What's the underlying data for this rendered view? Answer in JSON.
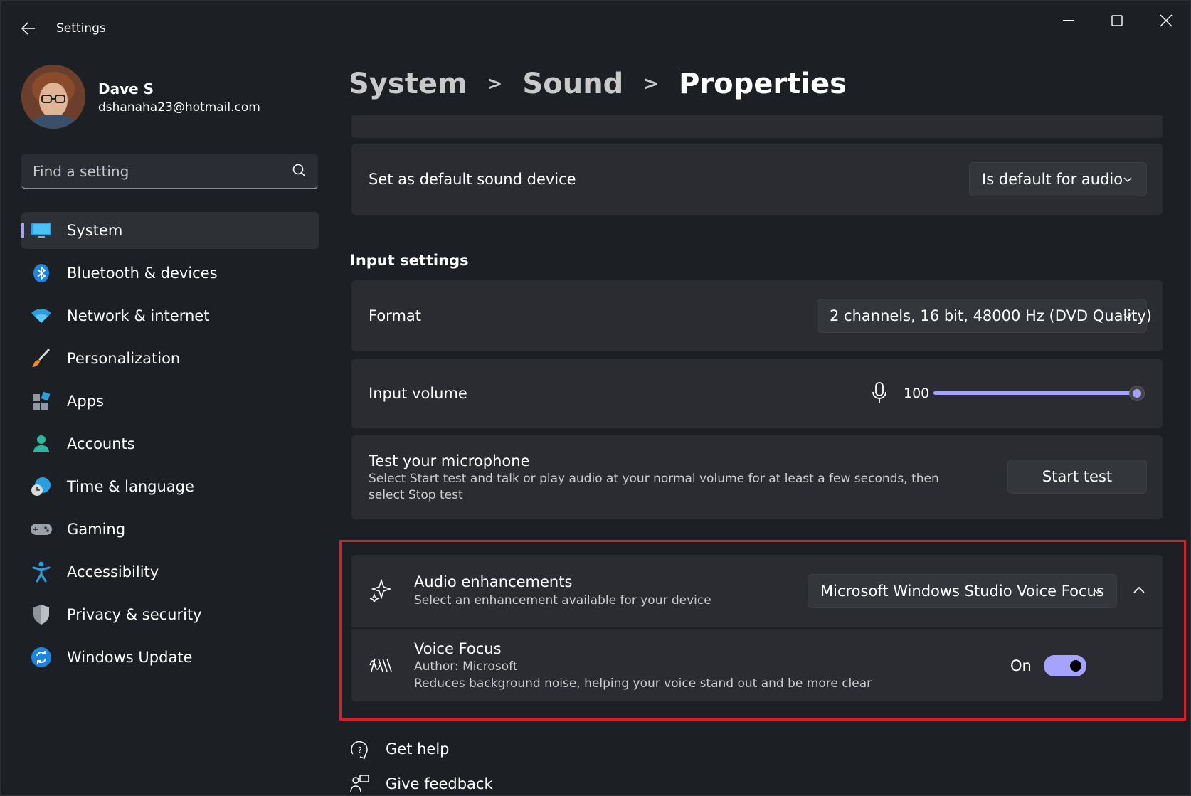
{
  "window": {
    "title": "Settings",
    "controls": {
      "minimize": "minimize",
      "maximize": "maximize",
      "close": "close"
    }
  },
  "profile": {
    "name": "Dave S",
    "email": "dshanaha23@hotmail.com"
  },
  "search": {
    "placeholder": "Find a setting"
  },
  "sidebar": {
    "items": [
      {
        "label": "System",
        "icon": "monitor-icon",
        "active": true
      },
      {
        "label": "Bluetooth & devices",
        "icon": "bluetooth-icon"
      },
      {
        "label": "Network & internet",
        "icon": "wifi-icon"
      },
      {
        "label": "Personalization",
        "icon": "brush-icon"
      },
      {
        "label": "Apps",
        "icon": "apps-icon"
      },
      {
        "label": "Accounts",
        "icon": "person-icon"
      },
      {
        "label": "Time & language",
        "icon": "clock-globe-icon"
      },
      {
        "label": "Gaming",
        "icon": "gamepad-icon"
      },
      {
        "label": "Accessibility",
        "icon": "accessibility-icon"
      },
      {
        "label": "Privacy & security",
        "icon": "shield-icon"
      },
      {
        "label": "Windows Update",
        "icon": "update-icon"
      }
    ]
  },
  "breadcrumb": {
    "items": [
      "System",
      "Sound",
      "Properties"
    ],
    "separator": ">"
  },
  "main": {
    "default_device": {
      "label": "Set as default sound device",
      "value": "Is default for audio"
    },
    "input_settings_title": "Input settings",
    "format": {
      "label": "Format",
      "value": "2 channels, 16 bit, 48000 Hz (DVD Quality)"
    },
    "input_volume": {
      "label": "Input volume",
      "value": "100",
      "level": 1.0
    },
    "test_mic": {
      "label": "Test your microphone",
      "description": "Select Start test and talk or play audio at your normal volume for at least a few seconds, then select Stop test",
      "button": "Start test"
    },
    "audio_enhancements": {
      "label": "Audio enhancements",
      "description": "Select an enhancement available for your device",
      "value": "Microsoft Windows Studio Voice Focus"
    },
    "voice_focus": {
      "label": "Voice Focus",
      "author": "Author: Microsoft",
      "description": "Reduces background noise, helping your voice stand out and be more clear",
      "toggle_label": "On",
      "toggle_on": true
    },
    "links": {
      "get_help": "Get help",
      "give_feedback": "Give feedback"
    }
  },
  "colors": {
    "accent": "#a6a3ff",
    "highlight_border": "#e11a26",
    "background": "#1c1f24",
    "card": "#2a2c31"
  }
}
